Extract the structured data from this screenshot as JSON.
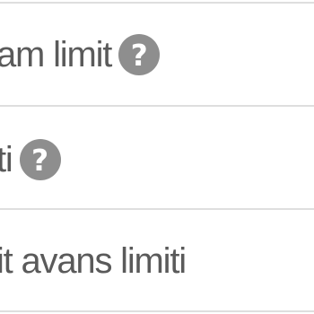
{
  "rows": [
    {
      "label": "am limit",
      "help_icon": "question-icon"
    },
    {
      "label": "ti",
      "help_icon": "question-icon"
    },
    {
      "label": "it avans limiti"
    }
  ],
  "help_icon_glyph": "?",
  "colors": {
    "text": "#5a5a5a",
    "icon_bg": "#8e8e8e",
    "divider": "#dedede"
  }
}
